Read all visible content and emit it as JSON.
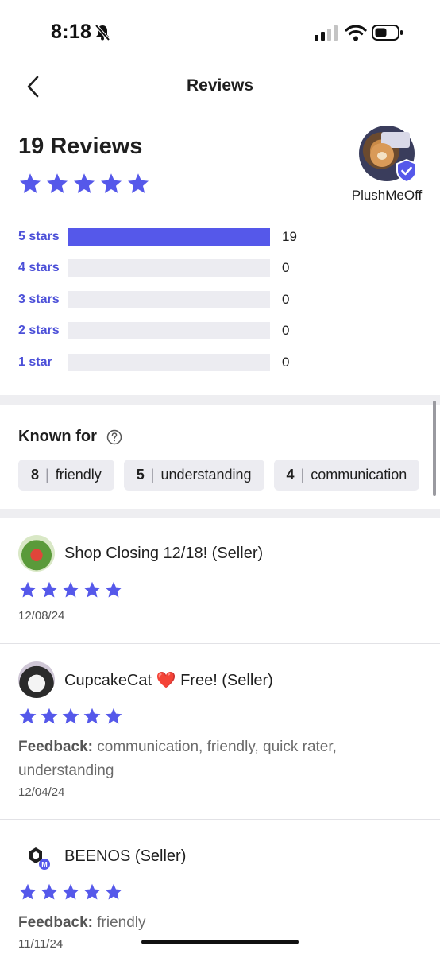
{
  "status_bar": {
    "time": "8:18"
  },
  "nav": {
    "title": "Reviews"
  },
  "summary": {
    "count_label": "19 Reviews",
    "rating": 5,
    "seller_name": "PlushMeOff"
  },
  "distribution": [
    {
      "label": "5 stars",
      "count": "19",
      "fraction": 1.0
    },
    {
      "label": "4 stars",
      "count": "0",
      "fraction": 0
    },
    {
      "label": "3 stars",
      "count": "0",
      "fraction": 0
    },
    {
      "label": "2 stars",
      "count": "0",
      "fraction": 0
    },
    {
      "label": "1 star",
      "count": "0",
      "fraction": 0
    }
  ],
  "known_for": {
    "title": "Known for",
    "chips": [
      {
        "num": "8",
        "label": "friendly"
      },
      {
        "num": "5",
        "label": "understanding"
      },
      {
        "num": "4",
        "label": "communication"
      }
    ]
  },
  "reviews": [
    {
      "name": "Shop Closing 12/18! (Seller)",
      "rating": 5,
      "feedback_label": "",
      "feedback": "",
      "date": "12/08/24"
    },
    {
      "name": "CupcakeCat ❤️ Free! (Seller)",
      "rating": 5,
      "feedback_label": "Feedback:",
      "feedback": "communication, friendly, quick rater, understanding",
      "date": "12/04/24"
    },
    {
      "name": "BEENOS (Seller)",
      "rating": 5,
      "feedback_label": "Feedback:",
      "feedback": "friendly",
      "date": "11/11/24"
    }
  ],
  "colors": {
    "accent": "#5558ea",
    "bar_bg": "#ececf1",
    "label": "#4b4fd8"
  }
}
